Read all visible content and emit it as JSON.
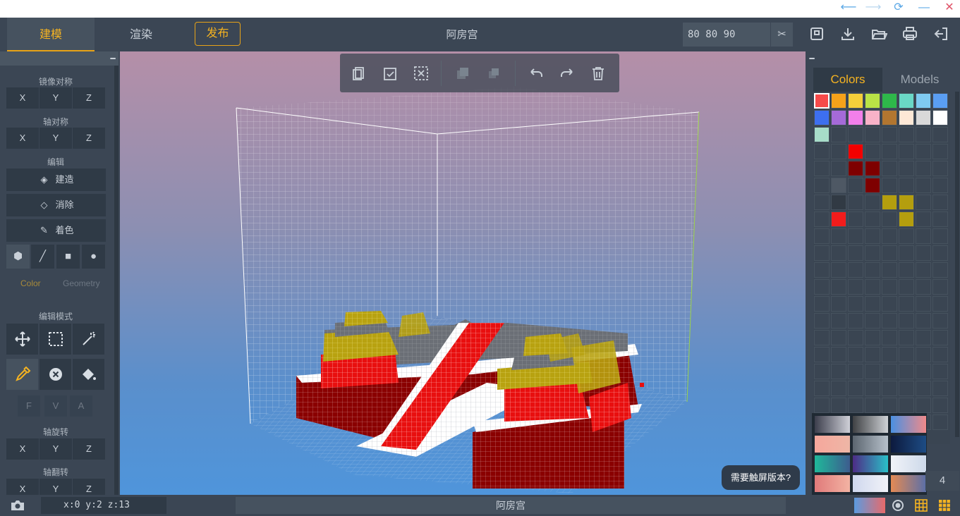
{
  "window": {
    "controls": [
      "⟵",
      "⟶",
      "⟳",
      "—",
      "✕"
    ]
  },
  "topbar": {
    "tab_model": "建模",
    "tab_render": "渲染",
    "publish": "发布",
    "title": "阿房宫",
    "dimensions": "80 80 90",
    "icons": [
      "scissors-icon",
      "save-icon",
      "download-icon",
      "folder-open-icon",
      "print-icon",
      "exit-icon"
    ]
  },
  "left_panel": {
    "mirror_label": "镜像对称",
    "mirror_axes": [
      "X",
      "Y",
      "Z"
    ],
    "axis_sym_label": "轴对称",
    "axis_sym_axes": [
      "X",
      "Y",
      "Z"
    ],
    "edit_label": "编辑",
    "build": "建造",
    "erase": "消除",
    "paint": "着色",
    "shape_icons": [
      "cube-icon",
      "line-icon",
      "square-icon",
      "circle-icon"
    ],
    "color_tab": "Color",
    "geometry_tab": "Geometry",
    "edit_mode_label": "编辑模式",
    "mode_icons": [
      "move-icon",
      "select-icon",
      "magic-wand-icon",
      "eyedropper-icon",
      "delete-icon",
      "fill-bucket-icon"
    ],
    "fva": [
      "F",
      "V",
      "A"
    ],
    "axis_rotate_label": "轴旋转",
    "axis_rotate_axes": [
      "X",
      "Y",
      "Z"
    ],
    "axis_flip_label": "轴翻转",
    "axis_flip_axes": [
      "X",
      "Y",
      "Z"
    ]
  },
  "viewport": {
    "toolbar_icons": [
      "copy-icon",
      "paste-icon",
      "clear-selection-icon",
      "duplicate-icon",
      "merge-icon",
      "undo-icon",
      "redo-icon",
      "trash-icon"
    ],
    "touch_prompt": "需要触屏版本?"
  },
  "right_panel": {
    "tab_colors": "Colors",
    "tab_models": "Models",
    "palette": [
      "#f64a4a",
      "#f6a21a",
      "#f4cf3a",
      "#b9e346",
      "#2eb84a",
      "#6ad8c6",
      "#7fcaf0",
      "#5a9ef2",
      "#3d6fef",
      "#a56ad8",
      "#f27fea",
      "#f8b2c8",
      "#b27630",
      "#fde8d6",
      "#d9d9d9",
      "#ffffff",
      "#a7dcc9"
    ],
    "custom_colors": [
      {
        "row": 3,
        "col": 2,
        "color": "#f20000"
      },
      {
        "row": 4,
        "col": 2,
        "color": "#7e0000"
      },
      {
        "row": 4,
        "col": 3,
        "color": "#7e0000"
      },
      {
        "row": 5,
        "col": 1,
        "color": "#4e5864"
      },
      {
        "row": 5,
        "col": 3,
        "color": "#7e0000"
      },
      {
        "row": 6,
        "col": 1,
        "color": "#313a44"
      },
      {
        "row": 6,
        "col": 4,
        "color": "#b49e0e"
      },
      {
        "row": 6,
        "col": 5,
        "color": "#b49e0e"
      },
      {
        "row": 7,
        "col": 1,
        "color": "#f21c1c"
      },
      {
        "row": 7,
        "col": 5,
        "color": "#b49e0e"
      }
    ],
    "gradients": [
      [
        "#3c3e4c",
        "#cfd0d8"
      ],
      [
        "#3f4144",
        "#cfd2d6"
      ],
      [
        "#4a90e2",
        "#f08a8a"
      ],
      [
        "#f6a79c",
        "#eeb6a6"
      ],
      [
        "#5c6670",
        "#b7c1cb"
      ],
      [
        "#0d1a3e",
        "#1d4c84"
      ],
      [
        "#1fb89a",
        "#3d5c8e"
      ],
      [
        "#4d2c86",
        "#2ac0c8"
      ],
      [
        "#f1f3f8",
        "#cdd9ea"
      ],
      [
        "#e07a7a",
        "#f3b3a3"
      ],
      [
        "#cfd8ee",
        "#f1f2f8"
      ],
      [
        "#e48a54",
        "#5a6fa8"
      ]
    ],
    "count": "4"
  },
  "statusbar": {
    "coords": "x:0  y:2  z:13",
    "name": "阿房宫"
  }
}
